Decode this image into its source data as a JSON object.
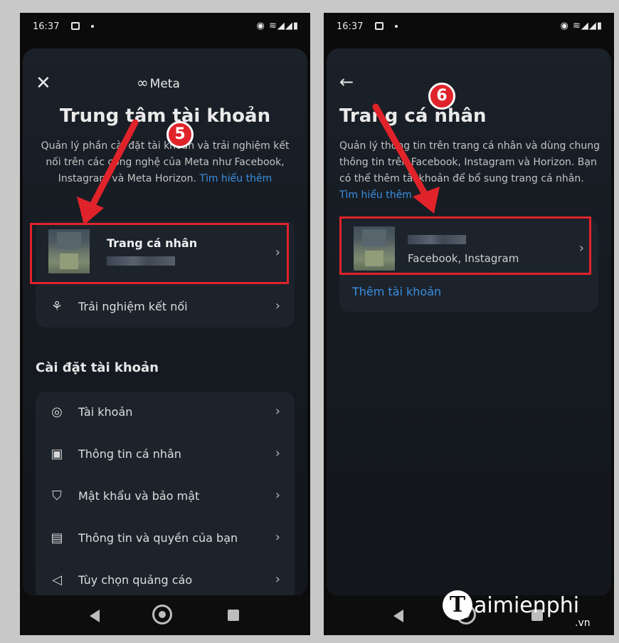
{
  "left": {
    "status_time": "16:37",
    "status_icons": "◉ ≋◢◢▮",
    "brand": "Meta",
    "title": "Trung tâm tài khoản",
    "description": "Quản lý phần cài đặt tài khoản và trải nghiệm kết nối trên các công nghệ của Meta như Facebook, Instagram và Meta Horizon.",
    "learn_more": "Tìm hiểu thêm",
    "profile_item": "Trang cá nhân",
    "connected_item": "Trải nghiệm kết nối",
    "section_title": "Cài đặt tài khoản",
    "settings": [
      {
        "label": "Tài khoản",
        "icon": "user-circle-icon"
      },
      {
        "label": "Thông tin cá nhân",
        "icon": "id-card-icon"
      },
      {
        "label": "Mật khẩu và bảo mật",
        "icon": "shield-icon"
      },
      {
        "label": "Thông tin và quyền của bạn",
        "icon": "document-lock-icon"
      },
      {
        "label": "Tùy chọn quảng cáo",
        "icon": "megaphone-icon"
      }
    ],
    "step_badge": "5"
  },
  "right": {
    "status_time": "16:37",
    "status_icons": "◉ ≋◢◢▮",
    "title": "Trang cá nhân",
    "description": "Quản lý thông tin trên trang cá nhân và dùng chung thông tin trên Facebook, Instagram và Horizon. Bạn có thể thêm tài khoản để bổ sung trang cá nhân.",
    "learn_more": "Tìm hiểu thêm",
    "profile_apps": "Facebook, Instagram",
    "add_account": "Thêm tài khoản",
    "step_badge": "6"
  },
  "watermark": {
    "letter": "T",
    "text": "aimienphi",
    "tld": ".vn"
  },
  "colors": {
    "highlight": "#e0232a",
    "link": "#3b8fe0"
  }
}
